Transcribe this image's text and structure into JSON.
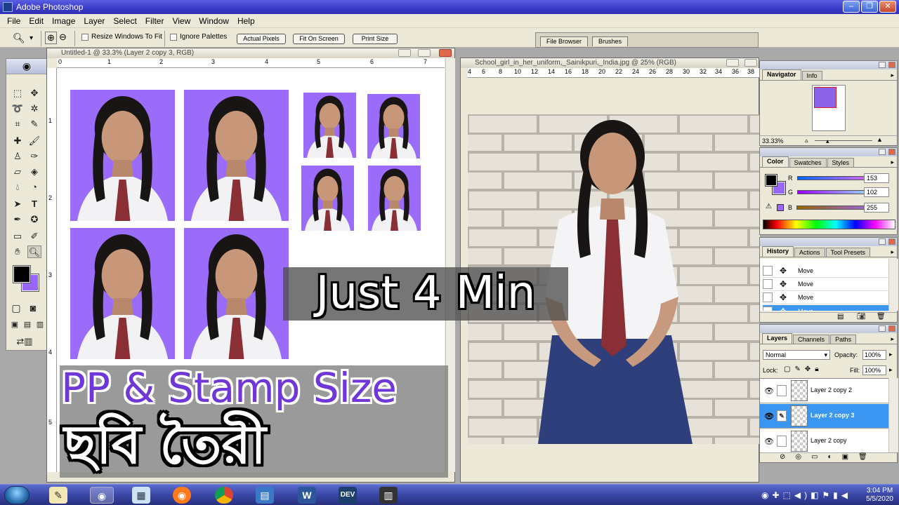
{
  "app": {
    "title": "Adobe Photoshop"
  },
  "window_buttons": {
    "minimize": "–",
    "maximize": "❐",
    "close": "✕"
  },
  "menu": [
    "File",
    "Edit",
    "Image",
    "Layer",
    "Select",
    "Filter",
    "View",
    "Window",
    "Help"
  ],
  "options": {
    "resize_windows": "Resize Windows To Fit",
    "ignore_palettes": "Ignore Palettes",
    "actual_pixels": "Actual Pixels",
    "fit_on_screen": "Fit On Screen",
    "print_size": "Print Size"
  },
  "palette_well": {
    "tabs": [
      "File Browser",
      "Brushes"
    ]
  },
  "doc1": {
    "title": "Untitled-1 @ 33.3% (Layer 2 copy 3, RGB)",
    "ruler_h": [
      "0",
      "1",
      "2",
      "3",
      "4",
      "5",
      "6",
      "7"
    ],
    "ruler_v": [
      "1",
      "2",
      "3",
      "4",
      "5"
    ]
  },
  "doc2": {
    "title": "School_girl_in_her_uniform,_Sainikpuri,_India.jpg @ 25% (RGB)",
    "ruler_h": [
      "4",
      "6",
      "8",
      "10",
      "12",
      "14",
      "16",
      "18",
      "20",
      "22",
      "24",
      "26",
      "28",
      "30",
      "32",
      "34",
      "36",
      "38"
    ]
  },
  "overlay": {
    "just": "Just 4 Min",
    "pp": "PP & Stamp Size",
    "bengali": "ছবি তৈরী"
  },
  "navigator": {
    "tabs": [
      "Navigator",
      "Info"
    ],
    "zoom": "33.33%"
  },
  "color": {
    "tabs": [
      "Color",
      "Swatches",
      "Styles"
    ],
    "r_label": "R",
    "g_label": "G",
    "b_label": "B",
    "r": "153",
    "g": "102",
    "b": "255",
    "foreground": "#000000",
    "background": "#9966ff"
  },
  "history": {
    "tabs": [
      "History",
      "Actions",
      "Tool Presets"
    ],
    "items": [
      "Move",
      "Move",
      "Move",
      "Move"
    ]
  },
  "layers": {
    "tabs": [
      "Layers",
      "Channels",
      "Paths"
    ],
    "blend": "Normal",
    "opacity_label": "Opacity:",
    "opacity": "100%",
    "lock_label": "Lock:",
    "fill_label": "Fill:",
    "fill": "100%",
    "items": [
      "Layer 2 copy 2",
      "Layer 2 copy 3",
      "Layer 2 copy"
    ]
  },
  "tray": {
    "time": "3:04 PM",
    "date": "5/5/2020"
  },
  "icons": [
    "zoom-icon",
    "move-icon",
    "marquee-icon",
    "lasso-icon",
    "crop-icon",
    "brush-icon",
    "eraser-icon",
    "eye-icon",
    "firefox-icon",
    "chrome-icon",
    "word-icon"
  ]
}
